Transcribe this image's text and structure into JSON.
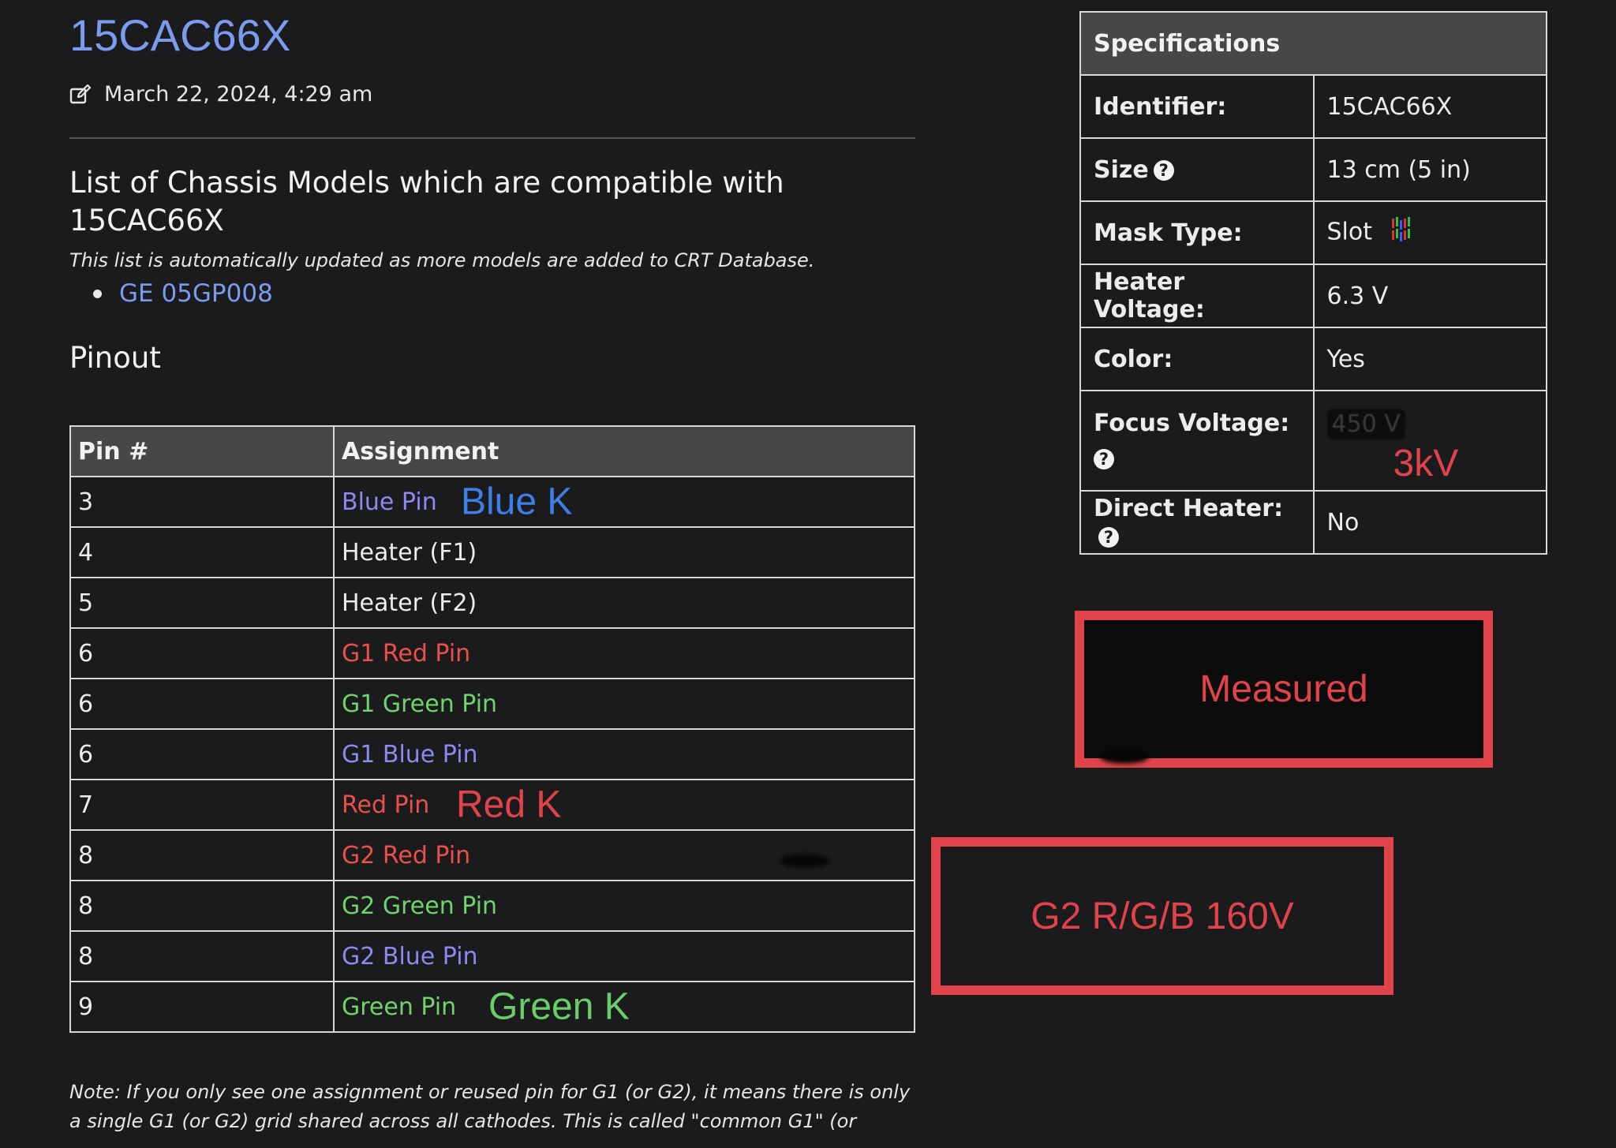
{
  "header": {
    "title": "15CAC66X",
    "timestamp": "March 22, 2024, 4:29 am",
    "edit_icon": "edit-icon"
  },
  "compatibility": {
    "heading": "List of Chassis Models which are compatible with 15CAC66X",
    "note": "This list is automatically updated as more models are added to CRT Database.",
    "models": [
      "GE 05GP008"
    ]
  },
  "pinout": {
    "heading": "Pinout",
    "columns": [
      "Pin #",
      "Assignment"
    ],
    "rows": [
      {
        "pin": "3",
        "assignment": "Blue Pin",
        "color": "blue",
        "annotation": "Blue K"
      },
      {
        "pin": "4",
        "assignment": "Heater (F1)",
        "color": "white",
        "annotation": ""
      },
      {
        "pin": "5",
        "assignment": "Heater (F2)",
        "color": "white",
        "annotation": ""
      },
      {
        "pin": "6",
        "assignment": "G1 Red Pin",
        "color": "red",
        "annotation": ""
      },
      {
        "pin": "6",
        "assignment": "G1 Green Pin",
        "color": "green",
        "annotation": ""
      },
      {
        "pin": "6",
        "assignment": "G1 Blue Pin",
        "color": "blue",
        "annotation": ""
      },
      {
        "pin": "7",
        "assignment": "Red Pin",
        "color": "red",
        "annotation": "Red K"
      },
      {
        "pin": "8",
        "assignment": "G2 Red Pin",
        "color": "red",
        "annotation": ""
      },
      {
        "pin": "8",
        "assignment": "G2 Green Pin",
        "color": "green",
        "annotation": ""
      },
      {
        "pin": "8",
        "assignment": "G2 Blue Pin",
        "color": "blue",
        "annotation": ""
      },
      {
        "pin": "9",
        "assignment": "Green Pin",
        "color": "green",
        "annotation": "Green K"
      }
    ],
    "footnote": "Note: If you only see one assignment or reused pin for G1 (or G2), it means there is only a single G1 (or G2) grid shared across all cathodes. This is called \"common G1\" (or"
  },
  "specifications": {
    "heading": "Specifications",
    "identifier_label": "Identifier:",
    "identifier_value": "15CAC66X",
    "size_label": "Size",
    "size_value": "13 cm (5 in)",
    "mask_label": "Mask Type:",
    "mask_value": "Slot",
    "heater_label": "Heater Voltage:",
    "heater_value": "6.3 V",
    "color_label": "Color:",
    "color_value": "Yes",
    "focus_label": "Focus Voltage:",
    "focus_value_original": "450 V",
    "focus_value_annotation": "3kV",
    "direct_heater_label": "Direct Heater:",
    "direct_heater_value": "No",
    "help_glyph": "?"
  },
  "annotations": {
    "measured": "Measured",
    "g2": "G2 R/G/B 160V"
  },
  "colors": {
    "background": "#1b1b1d",
    "link": "#7b9bee",
    "annotation_red": "#e0444a",
    "assign_blue": "#8a8af0",
    "assign_red": "#e85149",
    "assign_green": "#6fd46a"
  }
}
